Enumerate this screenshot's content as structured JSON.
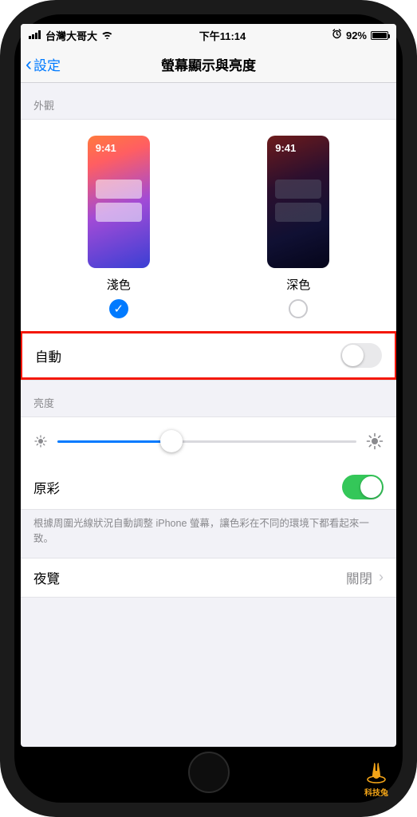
{
  "status": {
    "carrier": "台灣大哥大",
    "time": "下午11:14",
    "battery_pct": "92%"
  },
  "nav": {
    "back_label": "設定",
    "title": "螢幕顯示與亮度"
  },
  "appearance": {
    "header": "外觀",
    "preview_time": "9:41",
    "light_label": "淺色",
    "dark_label": "深色",
    "selected": "light",
    "auto_label": "自動",
    "auto_on": false
  },
  "brightness": {
    "header": "亮度",
    "value_pct": 38,
    "true_tone_label": "原彩",
    "true_tone_on": true,
    "footer": "根據周圍光線狀況自動調整 iPhone 螢幕，讓色彩在不同的環境下都看起來一致。"
  },
  "night_shift": {
    "label": "夜覽",
    "value": "關閉"
  },
  "logo_text": "科技兔"
}
